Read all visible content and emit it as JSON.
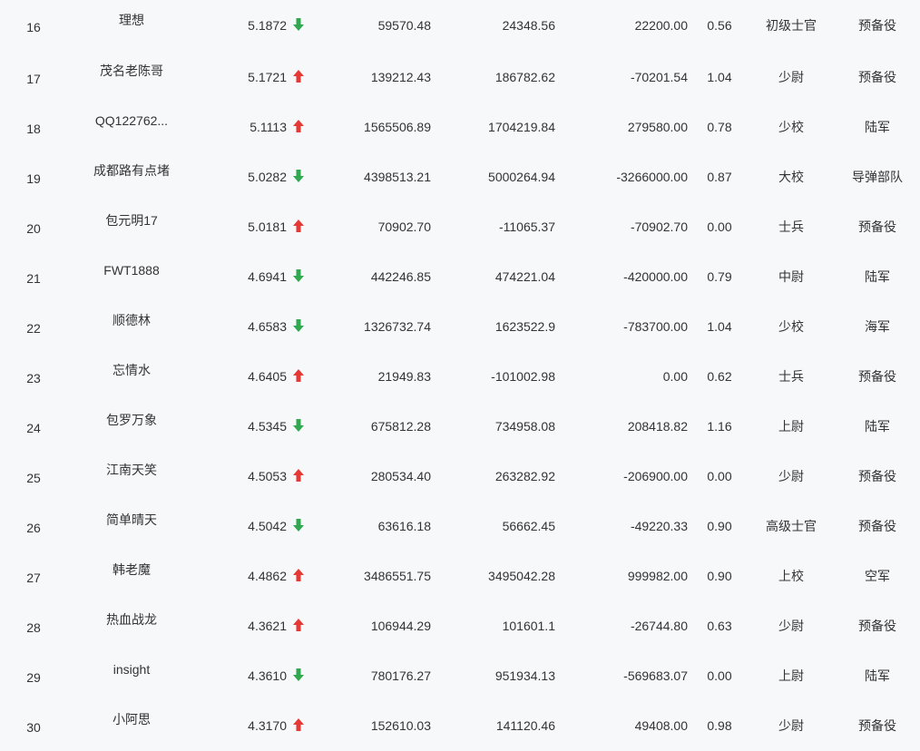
{
  "colors": {
    "up": "#e53935",
    "down": "#2fa84f",
    "text": "#333333",
    "background": "#f7f8fa"
  },
  "rows": [
    {
      "rank": "16",
      "name": "理想",
      "score": "5.1872",
      "trend": "down",
      "trend_icon": "arrow-down-icon",
      "v1": "59570.48",
      "v2": "24348.56",
      "v3": "22200.00",
      "ratio": "0.56",
      "title": "初级士官",
      "branch": "预备役"
    },
    {
      "rank": "17",
      "name": "茂名老陈哥",
      "score": "5.1721",
      "trend": "up",
      "trend_icon": "arrow-up-icon",
      "v1": "139212.43",
      "v2": "186782.62",
      "v3": "-70201.54",
      "ratio": "1.04",
      "title": "少尉",
      "branch": "预备役"
    },
    {
      "rank": "18",
      "name": "QQ122762...",
      "score": "5.1113",
      "trend": "up",
      "trend_icon": "arrow-up-icon",
      "v1": "1565506.89",
      "v2": "1704219.84",
      "v3": "279580.00",
      "ratio": "0.78",
      "title": "少校",
      "branch": "陆军"
    },
    {
      "rank": "19",
      "name": "成都路有点堵",
      "score": "5.0282",
      "trend": "down",
      "trend_icon": "arrow-down-icon",
      "v1": "4398513.21",
      "v2": "5000264.94",
      "v3": "-3266000.00",
      "ratio": "0.87",
      "title": "大校",
      "branch": "导弹部队"
    },
    {
      "rank": "20",
      "name": "包元明17",
      "score": "5.0181",
      "trend": "up",
      "trend_icon": "arrow-up-icon",
      "v1": "70902.70",
      "v2": "-11065.37",
      "v3": "-70902.70",
      "ratio": "0.00",
      "title": "士兵",
      "branch": "预备役"
    },
    {
      "rank": "21",
      "name": "FWT1888",
      "score": "4.6941",
      "trend": "down",
      "trend_icon": "arrow-down-icon",
      "v1": "442246.85",
      "v2": "474221.04",
      "v3": "-420000.00",
      "ratio": "0.79",
      "title": "中尉",
      "branch": "陆军"
    },
    {
      "rank": "22",
      "name": "顺德林",
      "score": "4.6583",
      "trend": "down",
      "trend_icon": "arrow-down-icon",
      "v1": "1326732.74",
      "v2": "1623522.9",
      "v3": "-783700.00",
      "ratio": "1.04",
      "title": "少校",
      "branch": "海军"
    },
    {
      "rank": "23",
      "name": "忘情水",
      "score": "4.6405",
      "trend": "up",
      "trend_icon": "arrow-up-icon",
      "v1": "21949.83",
      "v2": "-101002.98",
      "v3": "0.00",
      "ratio": "0.62",
      "title": "士兵",
      "branch": "预备役"
    },
    {
      "rank": "24",
      "name": "包罗万象",
      "score": "4.5345",
      "trend": "down",
      "trend_icon": "arrow-down-icon",
      "v1": "675812.28",
      "v2": "734958.08",
      "v3": "208418.82",
      "ratio": "1.16",
      "title": "上尉",
      "branch": "陆军"
    },
    {
      "rank": "25",
      "name": "江南天笑",
      "score": "4.5053",
      "trend": "up",
      "trend_icon": "arrow-up-icon",
      "v1": "280534.40",
      "v2": "263282.92",
      "v3": "-206900.00",
      "ratio": "0.00",
      "title": "少尉",
      "branch": "预备役"
    },
    {
      "rank": "26",
      "name": "简单晴天",
      "score": "4.5042",
      "trend": "down",
      "trend_icon": "arrow-down-icon",
      "v1": "63616.18",
      "v2": "56662.45",
      "v3": "-49220.33",
      "ratio": "0.90",
      "title": "高级士官",
      "branch": "预备役"
    },
    {
      "rank": "27",
      "name": "韩老魔",
      "score": "4.4862",
      "trend": "up",
      "trend_icon": "arrow-up-icon",
      "v1": "3486551.75",
      "v2": "3495042.28",
      "v3": "999982.00",
      "ratio": "0.90",
      "title": "上校",
      "branch": "空军"
    },
    {
      "rank": "28",
      "name": "热血战龙",
      "score": "4.3621",
      "trend": "up",
      "trend_icon": "arrow-up-icon",
      "v1": "106944.29",
      "v2": "101601.1",
      "v3": "-26744.80",
      "ratio": "0.63",
      "title": "少尉",
      "branch": "预备役"
    },
    {
      "rank": "29",
      "name": "insight",
      "score": "4.3610",
      "trend": "down",
      "trend_icon": "arrow-down-icon",
      "v1": "780176.27",
      "v2": "951934.13",
      "v3": "-569683.07",
      "ratio": "0.00",
      "title": "上尉",
      "branch": "陆军"
    },
    {
      "rank": "30",
      "name": "小阿思",
      "score": "4.3170",
      "trend": "up",
      "trend_icon": "arrow-up-icon",
      "v1": "152610.03",
      "v2": "141120.46",
      "v3": "49408.00",
      "ratio": "0.98",
      "title": "少尉",
      "branch": "预备役"
    }
  ]
}
